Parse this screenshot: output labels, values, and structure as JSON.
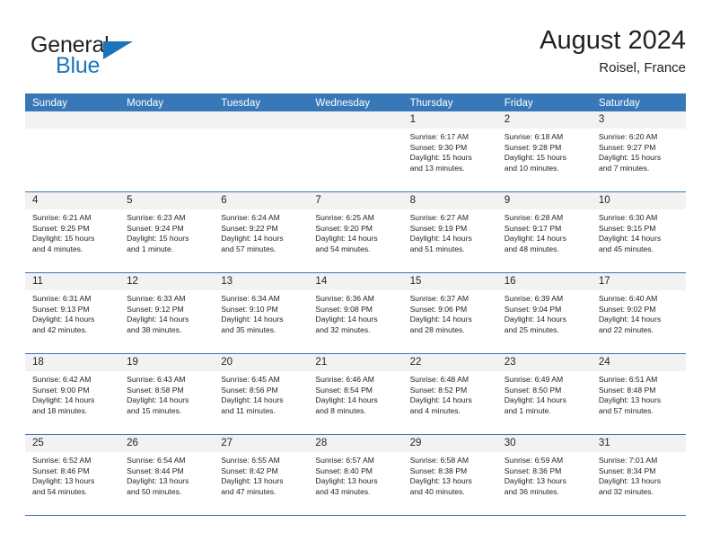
{
  "logo": {
    "word_general": "General",
    "word_blue": "Blue",
    "triangle_color": "#1b75bb"
  },
  "header": {
    "title": "August 2024",
    "subtitle": "Roisel, France"
  },
  "theme": {
    "header_row_bg": "#3878b8",
    "daynum_bg": "#f2f2f2",
    "grid_line": "#3878b8",
    "text": "#231f20"
  },
  "calendar": {
    "day_headers": [
      "Sunday",
      "Monday",
      "Tuesday",
      "Wednesday",
      "Thursday",
      "Friday",
      "Saturday"
    ],
    "weeks": [
      [
        {
          "day": "",
          "empty": true,
          "sunrise": "",
          "sunset": "",
          "daylight1": "",
          "daylight2": ""
        },
        {
          "day": "",
          "empty": true,
          "sunrise": "",
          "sunset": "",
          "daylight1": "",
          "daylight2": ""
        },
        {
          "day": "",
          "empty": true,
          "sunrise": "",
          "sunset": "",
          "daylight1": "",
          "daylight2": ""
        },
        {
          "day": "",
          "empty": true,
          "sunrise": "",
          "sunset": "",
          "daylight1": "",
          "daylight2": ""
        },
        {
          "day": "1",
          "sunrise": "Sunrise: 6:17 AM",
          "sunset": "Sunset: 9:30 PM",
          "daylight1": "Daylight: 15 hours",
          "daylight2": "and 13 minutes."
        },
        {
          "day": "2",
          "sunrise": "Sunrise: 6:18 AM",
          "sunset": "Sunset: 9:28 PM",
          "daylight1": "Daylight: 15 hours",
          "daylight2": "and 10 minutes."
        },
        {
          "day": "3",
          "sunrise": "Sunrise: 6:20 AM",
          "sunset": "Sunset: 9:27 PM",
          "daylight1": "Daylight: 15 hours",
          "daylight2": "and 7 minutes."
        }
      ],
      [
        {
          "day": "4",
          "sunrise": "Sunrise: 6:21 AM",
          "sunset": "Sunset: 9:25 PM",
          "daylight1": "Daylight: 15 hours",
          "daylight2": "and 4 minutes."
        },
        {
          "day": "5",
          "sunrise": "Sunrise: 6:23 AM",
          "sunset": "Sunset: 9:24 PM",
          "daylight1": "Daylight: 15 hours",
          "daylight2": "and 1 minute."
        },
        {
          "day": "6",
          "sunrise": "Sunrise: 6:24 AM",
          "sunset": "Sunset: 9:22 PM",
          "daylight1": "Daylight: 14 hours",
          "daylight2": "and 57 minutes."
        },
        {
          "day": "7",
          "sunrise": "Sunrise: 6:25 AM",
          "sunset": "Sunset: 9:20 PM",
          "daylight1": "Daylight: 14 hours",
          "daylight2": "and 54 minutes."
        },
        {
          "day": "8",
          "sunrise": "Sunrise: 6:27 AM",
          "sunset": "Sunset: 9:19 PM",
          "daylight1": "Daylight: 14 hours",
          "daylight2": "and 51 minutes."
        },
        {
          "day": "9",
          "sunrise": "Sunrise: 6:28 AM",
          "sunset": "Sunset: 9:17 PM",
          "daylight1": "Daylight: 14 hours",
          "daylight2": "and 48 minutes."
        },
        {
          "day": "10",
          "sunrise": "Sunrise: 6:30 AM",
          "sunset": "Sunset: 9:15 PM",
          "daylight1": "Daylight: 14 hours",
          "daylight2": "and 45 minutes."
        }
      ],
      [
        {
          "day": "11",
          "sunrise": "Sunrise: 6:31 AM",
          "sunset": "Sunset: 9:13 PM",
          "daylight1": "Daylight: 14 hours",
          "daylight2": "and 42 minutes."
        },
        {
          "day": "12",
          "sunrise": "Sunrise: 6:33 AM",
          "sunset": "Sunset: 9:12 PM",
          "daylight1": "Daylight: 14 hours",
          "daylight2": "and 38 minutes."
        },
        {
          "day": "13",
          "sunrise": "Sunrise: 6:34 AM",
          "sunset": "Sunset: 9:10 PM",
          "daylight1": "Daylight: 14 hours",
          "daylight2": "and 35 minutes."
        },
        {
          "day": "14",
          "sunrise": "Sunrise: 6:36 AM",
          "sunset": "Sunset: 9:08 PM",
          "daylight1": "Daylight: 14 hours",
          "daylight2": "and 32 minutes."
        },
        {
          "day": "15",
          "sunrise": "Sunrise: 6:37 AM",
          "sunset": "Sunset: 9:06 PM",
          "daylight1": "Daylight: 14 hours",
          "daylight2": "and 28 minutes."
        },
        {
          "day": "16",
          "sunrise": "Sunrise: 6:39 AM",
          "sunset": "Sunset: 9:04 PM",
          "daylight1": "Daylight: 14 hours",
          "daylight2": "and 25 minutes."
        },
        {
          "day": "17",
          "sunrise": "Sunrise: 6:40 AM",
          "sunset": "Sunset: 9:02 PM",
          "daylight1": "Daylight: 14 hours",
          "daylight2": "and 22 minutes."
        }
      ],
      [
        {
          "day": "18",
          "sunrise": "Sunrise: 6:42 AM",
          "sunset": "Sunset: 9:00 PM",
          "daylight1": "Daylight: 14 hours",
          "daylight2": "and 18 minutes."
        },
        {
          "day": "19",
          "sunrise": "Sunrise: 6:43 AM",
          "sunset": "Sunset: 8:58 PM",
          "daylight1": "Daylight: 14 hours",
          "daylight2": "and 15 minutes."
        },
        {
          "day": "20",
          "sunrise": "Sunrise: 6:45 AM",
          "sunset": "Sunset: 8:56 PM",
          "daylight1": "Daylight: 14 hours",
          "daylight2": "and 11 minutes."
        },
        {
          "day": "21",
          "sunrise": "Sunrise: 6:46 AM",
          "sunset": "Sunset: 8:54 PM",
          "daylight1": "Daylight: 14 hours",
          "daylight2": "and 8 minutes."
        },
        {
          "day": "22",
          "sunrise": "Sunrise: 6:48 AM",
          "sunset": "Sunset: 8:52 PM",
          "daylight1": "Daylight: 14 hours",
          "daylight2": "and 4 minutes."
        },
        {
          "day": "23",
          "sunrise": "Sunrise: 6:49 AM",
          "sunset": "Sunset: 8:50 PM",
          "daylight1": "Daylight: 14 hours",
          "daylight2": "and 1 minute."
        },
        {
          "day": "24",
          "sunrise": "Sunrise: 6:51 AM",
          "sunset": "Sunset: 8:48 PM",
          "daylight1": "Daylight: 13 hours",
          "daylight2": "and 57 minutes."
        }
      ],
      [
        {
          "day": "25",
          "sunrise": "Sunrise: 6:52 AM",
          "sunset": "Sunset: 8:46 PM",
          "daylight1": "Daylight: 13 hours",
          "daylight2": "and 54 minutes."
        },
        {
          "day": "26",
          "sunrise": "Sunrise: 6:54 AM",
          "sunset": "Sunset: 8:44 PM",
          "daylight1": "Daylight: 13 hours",
          "daylight2": "and 50 minutes."
        },
        {
          "day": "27",
          "sunrise": "Sunrise: 6:55 AM",
          "sunset": "Sunset: 8:42 PM",
          "daylight1": "Daylight: 13 hours",
          "daylight2": "and 47 minutes."
        },
        {
          "day": "28",
          "sunrise": "Sunrise: 6:57 AM",
          "sunset": "Sunset: 8:40 PM",
          "daylight1": "Daylight: 13 hours",
          "daylight2": "and 43 minutes."
        },
        {
          "day": "29",
          "sunrise": "Sunrise: 6:58 AM",
          "sunset": "Sunset: 8:38 PM",
          "daylight1": "Daylight: 13 hours",
          "daylight2": "and 40 minutes."
        },
        {
          "day": "30",
          "sunrise": "Sunrise: 6:59 AM",
          "sunset": "Sunset: 8:36 PM",
          "daylight1": "Daylight: 13 hours",
          "daylight2": "and 36 minutes."
        },
        {
          "day": "31",
          "sunrise": "Sunrise: 7:01 AM",
          "sunset": "Sunset: 8:34 PM",
          "daylight1": "Daylight: 13 hours",
          "daylight2": "and 32 minutes."
        }
      ]
    ]
  }
}
